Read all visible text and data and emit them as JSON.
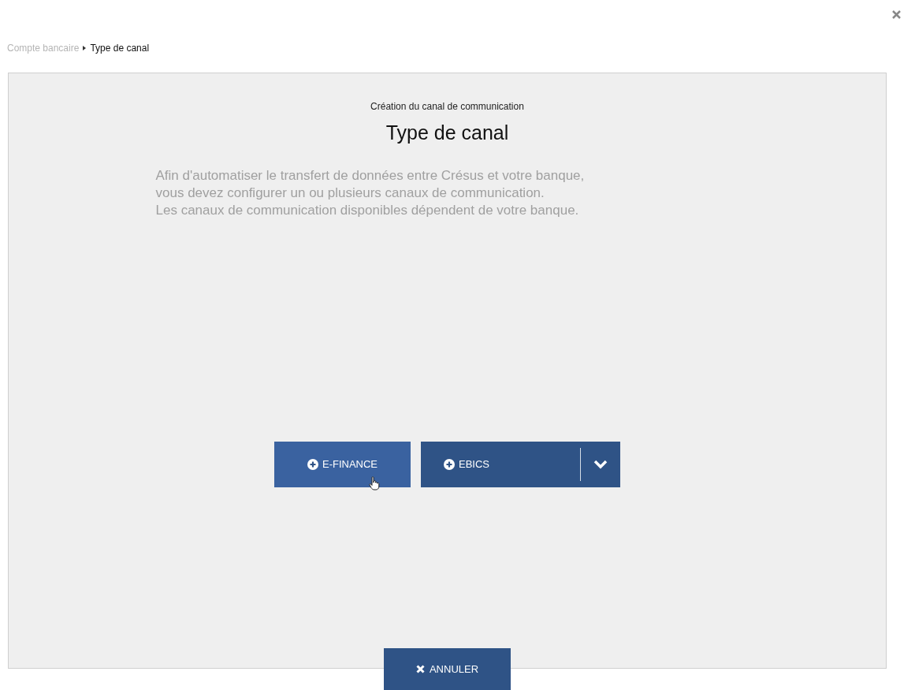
{
  "breadcrumb": [
    {
      "label": "Compte bancaire",
      "current": false
    },
    {
      "label": "Type de canal",
      "current": true
    }
  ],
  "dialog": {
    "subtitle": "Création du canal de communication",
    "title": "Type de canal",
    "description": [
      "Afin d'automatiser le transfert de données entre Crésus et votre banque,",
      "vous devez configurer un ou plusieurs canaux de communication.",
      "Les canaux de communication disponibles dépendent de votre banque."
    ],
    "buttons": [
      {
        "label": "E-FINANCE",
        "kind": "plain",
        "hovered": true
      },
      {
        "label": "EBICS",
        "kind": "split",
        "hovered": false
      }
    ]
  },
  "cancel_button": {
    "label": "ANNULER"
  }
}
